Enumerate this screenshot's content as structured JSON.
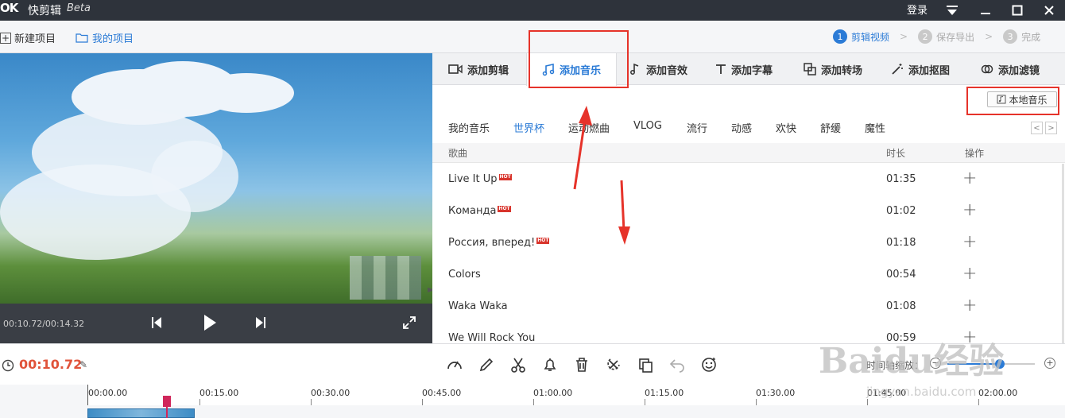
{
  "titlebar": {
    "logo": "OK",
    "app_name": "快剪辑",
    "beta": "Beta",
    "login": "登录"
  },
  "toolbar": {
    "new_project": "新建项目",
    "my_project": "我的项目",
    "steps": [
      {
        "num": "1",
        "label": "剪辑视频"
      },
      {
        "num": "2",
        "label": "保存导出"
      },
      {
        "num": "3",
        "label": "完成"
      }
    ]
  },
  "player": {
    "time": "00:10.72/00:14.32"
  },
  "tabs": [
    "添加剪辑",
    "添加音乐",
    "添加音效",
    "添加字幕",
    "添加转场",
    "添加抠图",
    "添加滤镜"
  ],
  "local_music": "本地音乐",
  "categories": [
    "我的音乐",
    "世界杯",
    "运动燃曲",
    "VLOG",
    "流行",
    "动感",
    "欢快",
    "舒缓",
    "魔性"
  ],
  "list_head": {
    "song": "歌曲",
    "duration": "时长",
    "action": "操作"
  },
  "songs": [
    {
      "title": "Live It Up",
      "hot": "HOT",
      "duration": "01:35",
      "add": "+"
    },
    {
      "title": "Команда",
      "hot": "HOT",
      "duration": "01:02",
      "add": "+"
    },
    {
      "title": "Россия, вперед!",
      "hot": "HOT",
      "duration": "01:18",
      "add": "+"
    },
    {
      "title": "Colors",
      "duration": "00:54",
      "add": "+"
    },
    {
      "title": "Waka Waka",
      "duration": "01:08",
      "add": "+"
    },
    {
      "title": "We Will Rock You",
      "duration": "00:59",
      "add": "+"
    }
  ],
  "editbar": {
    "current_time": "00:10.72",
    "zoom_label": "时间轴缩放："
  },
  "zoom_level": 0.6,
  "timeline_ticks": [
    "00:00.00",
    "00:15.00",
    "00:30.00",
    "00:45.00",
    "01:00.00",
    "01:15.00",
    "01:30.00",
    "01:45.00",
    "02:00.00"
  ],
  "watermark": {
    "big": "Baidu经验",
    "small": "jingyan.baidu.com"
  },
  "colors": {
    "accent": "#2b7bd6",
    "titlebar": "#2e333b",
    "annotation": "#e6332a",
    "time": "#e0533a"
  }
}
